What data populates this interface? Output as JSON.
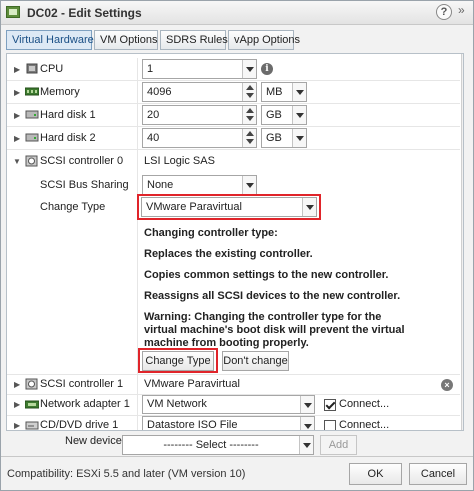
{
  "window": {
    "title": "DC02 - Edit Settings",
    "help": "?"
  },
  "tabs": [
    {
      "label": "Virtual Hardware",
      "active": true
    },
    {
      "label": "VM Options",
      "active": false
    },
    {
      "label": "SDRS Rules",
      "active": false
    },
    {
      "label": "vApp Options",
      "active": false
    }
  ],
  "hardware": {
    "cpu": {
      "label": "CPU",
      "value": "1"
    },
    "memory": {
      "label": "Memory",
      "value": "4096",
      "unit": "MB"
    },
    "hard_disk_1": {
      "label": "Hard disk 1",
      "value": "20",
      "unit": "GB"
    },
    "hard_disk_2": {
      "label": "Hard disk 2",
      "value": "40",
      "unit": "GB"
    },
    "scsi_controller_0": {
      "label": "SCSI controller 0",
      "type": "LSI Logic SAS",
      "bus_sharing_label": "SCSI Bus Sharing",
      "bus_sharing_value": "None",
      "change_type_label": "Change Type",
      "change_type_value": "VMware Paravirtual",
      "notes": [
        "Changing controller type:",
        "Replaces the existing controller.",
        "Copies common settings to the new controller.",
        "Reassigns all SCSI devices to the new controller.",
        "Warning: Changing the controller type for the virtual machine's boot disk will prevent the virtual machine from booting properly."
      ],
      "change_button": "Change Type",
      "dont_change_button": "Don't change"
    },
    "scsi_controller_1": {
      "label": "SCSI controller 1",
      "value": "VMware Paravirtual"
    },
    "network_adapter_1": {
      "label": "Network adapter 1",
      "value": "VM Network",
      "connect_label": "Connect..."
    },
    "cd_dvd_drive_1": {
      "label": "CD/DVD drive 1",
      "value": "Datastore ISO File",
      "connect_label": "Connect..."
    }
  },
  "new_device": {
    "label": "New device:",
    "select_value": "-------- Select --------",
    "add_button": "Add"
  },
  "footer": {
    "compatibility": "Compatibility: ESXi 5.5 and later (VM version 10)",
    "ok_button": "OK",
    "cancel_button": "Cancel"
  },
  "colors": {
    "highlight_box": "#e0242a",
    "active_tab": "#1a4f85"
  },
  "icons": [
    "vm-icon",
    "cpu-icon",
    "memory-icon",
    "disk-icon",
    "scsi-icon",
    "network-icon",
    "cdrom-icon",
    "info-icon",
    "remove-icon"
  ]
}
